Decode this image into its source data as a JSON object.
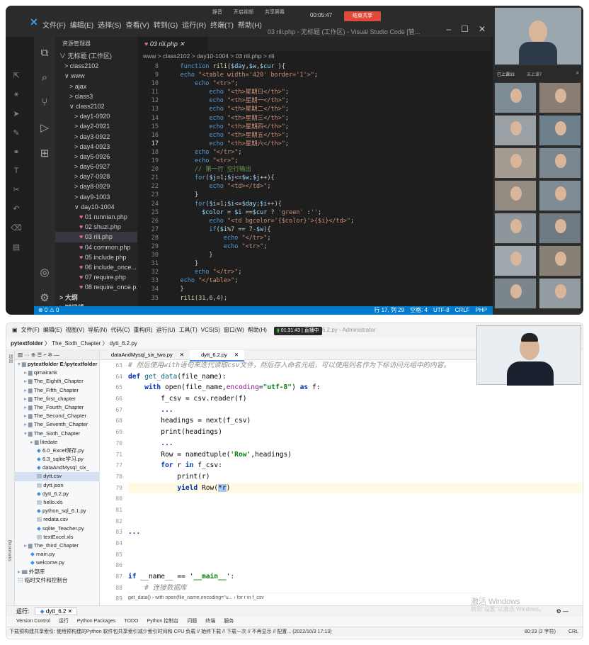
{
  "vscode": {
    "menus": [
      "文件(F)",
      "编辑(E)",
      "选择(S)",
      "查看(V)",
      "转到(G)",
      "运行(R)",
      "终端(T)",
      "帮助(H)"
    ],
    "window_title": "03 rili.php - 无标题 (工作区) - Visual Studio Code [管...",
    "timer": "00:05:47",
    "meeting_btn": "结束共享",
    "toolbar_items": [
      "静音",
      "开启视频",
      "共享屏幕"
    ],
    "explorer_title": "资源管理器",
    "tree": [
      {
        "label": "无标题 (工作区)",
        "indent": 0,
        "arrow": "∨"
      },
      {
        "label": "class2102",
        "indent": 1,
        "arrow": ">"
      },
      {
        "label": "www",
        "indent": 1,
        "arrow": "∨"
      },
      {
        "label": "ajax",
        "indent": 2,
        "arrow": ">"
      },
      {
        "label": "class3",
        "indent": 2,
        "arrow": ">"
      },
      {
        "label": "class2102",
        "indent": 2,
        "arrow": "∨"
      },
      {
        "label": "day1-0920",
        "indent": 3,
        "arrow": ">"
      },
      {
        "label": "day2-0921",
        "indent": 3,
        "arrow": ">"
      },
      {
        "label": "day3-0922",
        "indent": 3,
        "arrow": ">"
      },
      {
        "label": "day4-0923",
        "indent": 3,
        "arrow": ">"
      },
      {
        "label": "day5-0926",
        "indent": 3,
        "arrow": ">"
      },
      {
        "label": "day6-0927",
        "indent": 3,
        "arrow": ">"
      },
      {
        "label": "day7-0928",
        "indent": 3,
        "arrow": ">"
      },
      {
        "label": "day8-0929",
        "indent": 3,
        "arrow": ">"
      },
      {
        "label": "day9-1003",
        "indent": 3,
        "arrow": ">"
      },
      {
        "label": "day10-1004",
        "indent": 3,
        "arrow": "∨"
      },
      {
        "label": "01 runnian.php",
        "indent": 4,
        "arrow": "php"
      },
      {
        "label": "02 shuzi.php",
        "indent": 4,
        "arrow": "php"
      },
      {
        "label": "03 rili.php",
        "indent": 4,
        "arrow": "php",
        "selected": true
      },
      {
        "label": "04 common.php",
        "indent": 4,
        "arrow": "php"
      },
      {
        "label": "05 include.php",
        "indent": 4,
        "arrow": "php"
      },
      {
        "label": "06 include_once...",
        "indent": 4,
        "arrow": "php"
      },
      {
        "label": "07 require.php",
        "indent": 4,
        "arrow": "php"
      },
      {
        "label": "08 require_once.p...",
        "indent": 4,
        "arrow": "php"
      },
      {
        "label": "大纲",
        "indent": 0,
        "arrow": ">"
      },
      {
        "label": "时间线",
        "indent": 0,
        "arrow": ">"
      }
    ],
    "tab_label": "03 rili.php",
    "breadcrumb": "www > class2102 > day10-1004 > 03 rili.php > rili",
    "status_left": "⊗ 0 ⚠ 0",
    "status_right": [
      "行 17, 列 29",
      "空格: 4",
      "UTF-8",
      "CRLF",
      "PHP"
    ],
    "participants": {
      "label_left": "已上课33",
      "label_mid": "未上课7"
    }
  },
  "pycharm": {
    "menus": [
      "文件(F)",
      "编辑(E)",
      "视图(V)",
      "导航(N)",
      "代码(C)",
      "重构(R)",
      "运行(U)",
      "工具(T)",
      "VCS(S)",
      "窗口(W)",
      "帮助(H)"
    ],
    "live_time": "01:31:43",
    "live_label": "直播中",
    "title_suffix": "6.2.py - Administrator",
    "nav_project": "pytextfolder",
    "nav_folder": "The_Sixth_Chapter",
    "nav_file": "dytt_6.2.py",
    "project_root": "pytextfolder",
    "project_root_path": "E:\\pytextfolder",
    "tree": [
      {
        "label": "pytextfolder E:\\pytextfolder",
        "indent": 0,
        "type": "dir-open"
      },
      {
        "label": "qimairank",
        "indent": 1,
        "type": "dir"
      },
      {
        "label": "The_Eighth_Chapter",
        "indent": 1,
        "type": "dir"
      },
      {
        "label": "The_Fifth_Chapter",
        "indent": 1,
        "type": "dir"
      },
      {
        "label": "The_first_chapter",
        "indent": 1,
        "type": "dir"
      },
      {
        "label": "The_Fourth_Chapter",
        "indent": 1,
        "type": "dir"
      },
      {
        "label": "The_Second_Chapter",
        "indent": 1,
        "type": "dir"
      },
      {
        "label": "The_Seventh_Chapter",
        "indent": 1,
        "type": "dir"
      },
      {
        "label": "The_Sixth_Chapter",
        "indent": 1,
        "type": "dir-open"
      },
      {
        "label": "litedate",
        "indent": 2,
        "type": "dir"
      },
      {
        "label": "6.0_Excel保存.py",
        "indent": 3,
        "type": "py"
      },
      {
        "label": "6.3_sqlite学习.py",
        "indent": 3,
        "type": "py"
      },
      {
        "label": "dataAndMysql_six_",
        "indent": 3,
        "type": "py"
      },
      {
        "label": "dytt.csv",
        "indent": 3,
        "type": "file",
        "selected": true
      },
      {
        "label": "dytt.json",
        "indent": 3,
        "type": "file"
      },
      {
        "label": "dytt_6.2.py",
        "indent": 3,
        "type": "py"
      },
      {
        "label": "hello.xls",
        "indent": 3,
        "type": "file"
      },
      {
        "label": "python_sql_6.1.py",
        "indent": 3,
        "type": "py"
      },
      {
        "label": "redata.csv",
        "indent": 3,
        "type": "file"
      },
      {
        "label": "sqlite_Teacher.py",
        "indent": 3,
        "type": "py"
      },
      {
        "label": "textExcel.xls",
        "indent": 3,
        "type": "file"
      },
      {
        "label": "The_third_Chapter",
        "indent": 1,
        "type": "dir"
      },
      {
        "label": "main.py",
        "indent": 2,
        "type": "py"
      },
      {
        "label": "welcome.py",
        "indent": 2,
        "type": "py"
      },
      {
        "label": "外部库",
        "indent": 0,
        "type": "dir"
      },
      {
        "label": "临时文件和控制台",
        "indent": 0,
        "type": "file"
      }
    ],
    "tabs": [
      "dataAndMysql_six_two.py",
      "dytt_6.2.py"
    ],
    "line_numbers": [
      "63",
      "64",
      "65",
      "66",
      "67",
      "68",
      "69",
      "70",
      "71",
      "77",
      "78",
      "79",
      "80",
      "81",
      "82",
      "83",
      "84",
      "85",
      "86",
      "87",
      "88",
      "89",
      "90"
    ],
    "editor_crumbs": "get_data()  ›  with open(file_name,encoding=\"u...  ›  for r in f_csv",
    "run_label": "运行:",
    "run_config": "dytt_6.2",
    "bottom_tools": [
      "Version Control",
      "运行",
      "Python Packages",
      "TODO",
      "Python 控制台",
      "问题",
      "终端",
      "服务"
    ],
    "status": "下载预构建共享索引: 使用预构建的Python 软件包共享索引减少索引时间和 CPU 负载 // 始终下载 // 下载一次 // 不再显示 // 配置... (2022/10/3 17:13)",
    "status_pos": "80:23 (2 字符)",
    "status_crlf": "CRL",
    "watermark": "激活 Windows",
    "watermark2": "转到\"设置\"以激活 Windows。"
  }
}
